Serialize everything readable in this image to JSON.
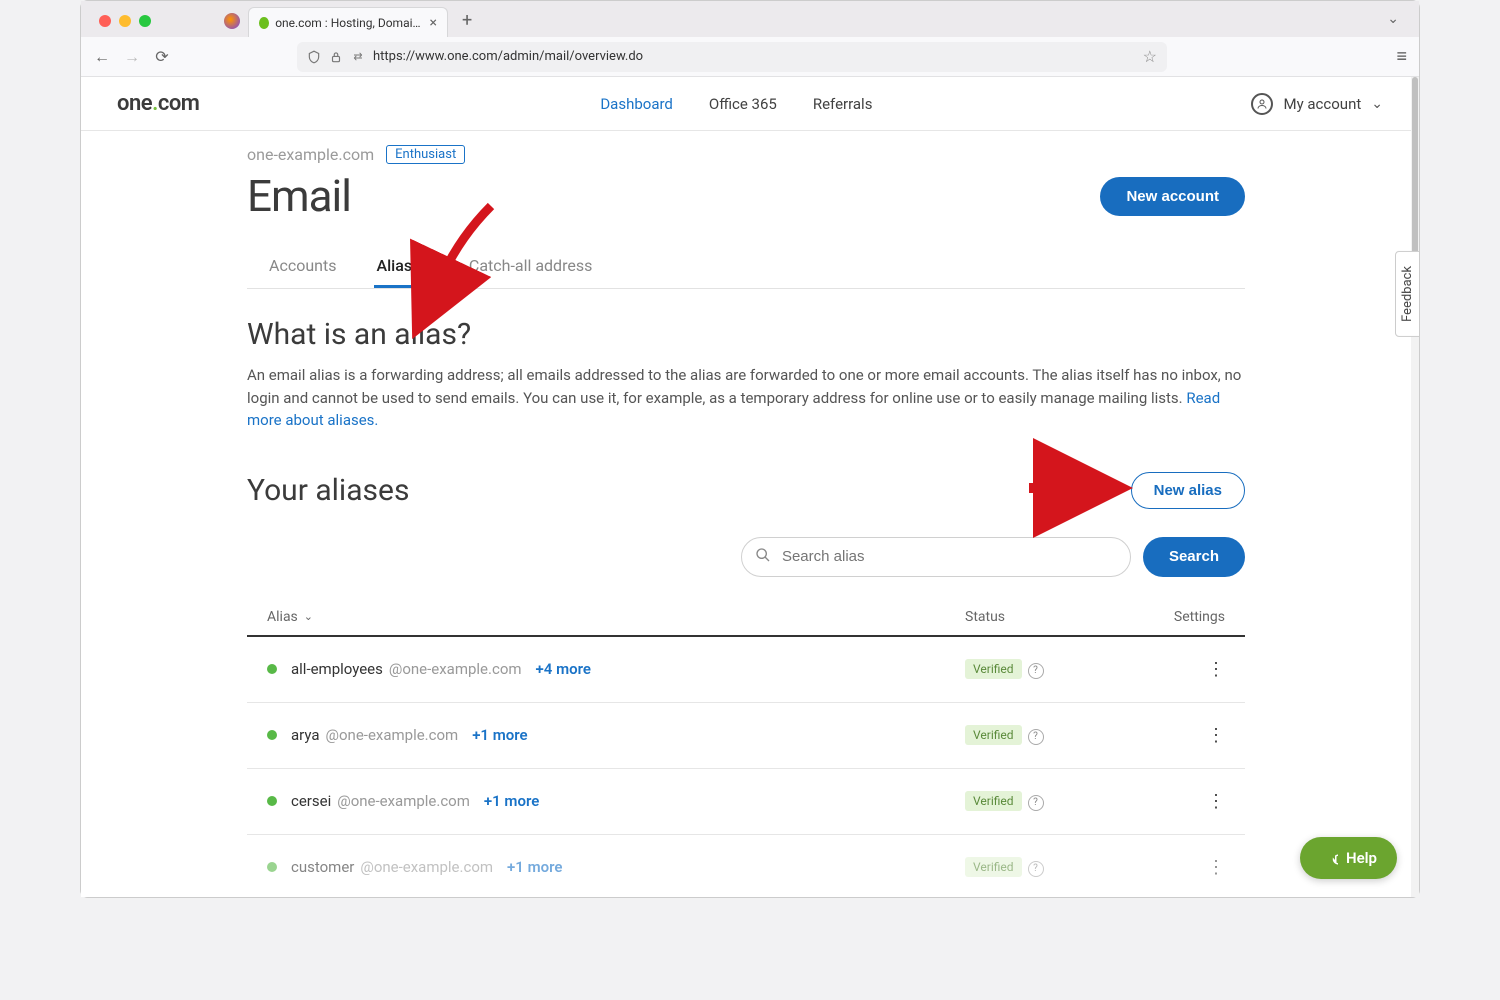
{
  "browser": {
    "tab_title": "one.com : Hosting, Domain, Em…",
    "url": "https://www.one.com/admin/mail/overview.do"
  },
  "header": {
    "logo_base": "one",
    "logo_tld": "com",
    "nav": {
      "dashboard": "Dashboard",
      "office365": "Office 365",
      "referrals": "Referrals"
    },
    "account_label": "My account"
  },
  "page": {
    "domain": "one-example.com",
    "plan_badge": "Enthusiast",
    "title": "Email",
    "new_account_btn": "New account",
    "tabs": {
      "accounts": "Accounts",
      "aliases": "Aliases",
      "catchall": "Catch-all address"
    },
    "what_heading": "What is an alias?",
    "what_body": "An email alias is a forwarding address; all emails addressed to the alias are forwarded to one or more email accounts. The alias itself has no inbox, no login and cannot be used to send emails. You can use it, for example, as a temporary address for online use or to easily manage mailing lists. ",
    "what_link": "Read more about aliases.",
    "your_aliases_heading": "Your aliases",
    "new_alias_btn": "New alias",
    "search_placeholder": "Search alias",
    "search_btn": "Search",
    "columns": {
      "alias": "Alias",
      "status": "Status",
      "settings": "Settings"
    },
    "rows": [
      {
        "local": "all-employees",
        "domain": "@one-example.com",
        "more": "+4 more",
        "status": "Verified"
      },
      {
        "local": "arya",
        "domain": "@one-example.com",
        "more": "+1 more",
        "status": "Verified"
      },
      {
        "local": "cersei",
        "domain": "@one-example.com",
        "more": "+1 more",
        "status": "Verified"
      },
      {
        "local": "customer",
        "domain": "@one-example.com",
        "more": "+1 more",
        "status": "Verified"
      }
    ]
  },
  "widgets": {
    "feedback": "Feedback",
    "help": "Help"
  }
}
